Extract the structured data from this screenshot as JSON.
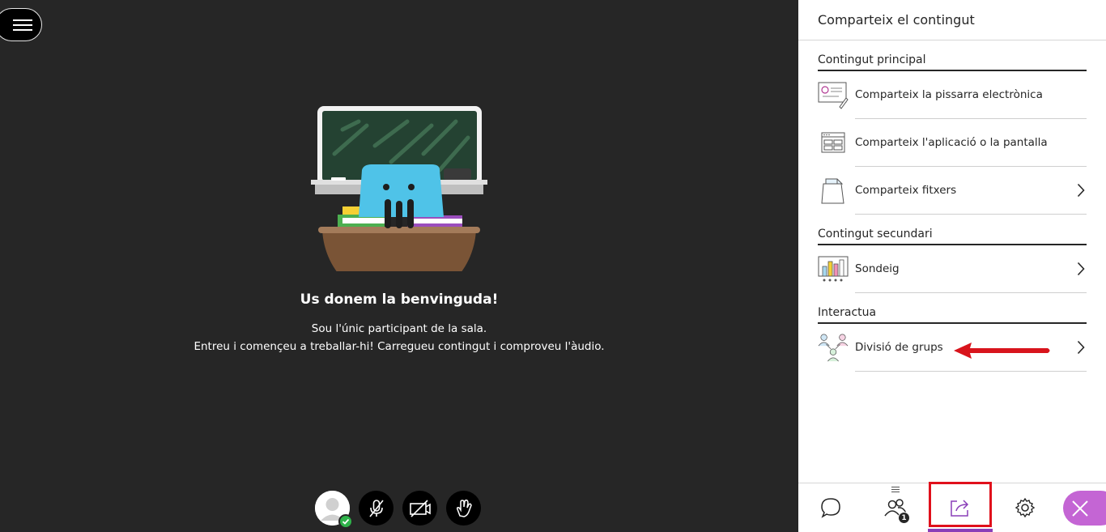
{
  "stage": {
    "menu_button": "menu-icon",
    "welcome_title": "Us donem la benvinguda!",
    "welcome_line1": "Sou l'únic participant de la sala.",
    "welcome_line2": "Entreu i començeu a treballar-hi! Carregueu contingut i comproveu l'àudio.",
    "controls": [
      {
        "name": "avatar",
        "icon": "user-icon",
        "status": "check-icon"
      },
      {
        "name": "microphone-button",
        "icon": "mic-off-icon"
      },
      {
        "name": "camera-button",
        "icon": "camera-off-icon"
      },
      {
        "name": "raise-hand-button",
        "icon": "hand-icon"
      }
    ]
  },
  "panel": {
    "title": "Comparteix el contingut",
    "sections": [
      {
        "title": "Contingut principal",
        "items": [
          {
            "label": "Comparteix la pissarra electrònica",
            "icon": "whiteboard-icon",
            "chevron": false
          },
          {
            "label": "Comparteix l'aplicació o la pantalla",
            "icon": "screen-icon",
            "chevron": false
          },
          {
            "label": "Comparteix fitxers",
            "icon": "files-icon",
            "chevron": true
          }
        ]
      },
      {
        "title": "Contingut secundari",
        "items": [
          {
            "label": "Sondeig",
            "icon": "poll-icon",
            "chevron": true
          }
        ]
      },
      {
        "title": "Interactua",
        "items": [
          {
            "label": "Divisió de grups",
            "icon": "groups-icon",
            "chevron": true
          }
        ]
      }
    ]
  },
  "bottom_nav": {
    "chat": "chat-icon",
    "people": "people-icon",
    "people_count": "1",
    "share": "share-icon",
    "settings": "gear-icon",
    "close": "close-icon"
  },
  "colors": {
    "stage_bg": "#262626",
    "accent_purple": "#8a3fb8",
    "close_purple": "#c465d4",
    "highlight_red": "#e0101b"
  }
}
